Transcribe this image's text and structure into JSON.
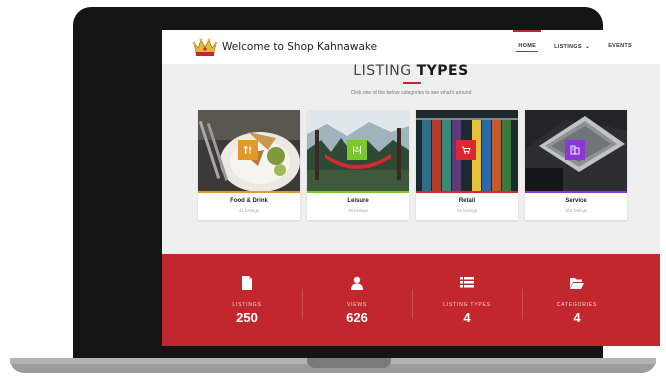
{
  "header": {
    "site_title": "Welcome to Shop Kahnawake",
    "nav": [
      {
        "label": "HOME",
        "active": true
      },
      {
        "label": "LISTINGS",
        "dropdown_icon": "chevron-down-icon"
      },
      {
        "label": "EVENTS"
      }
    ]
  },
  "section": {
    "title_light": "LISTING",
    "title_bold": "TYPES",
    "subtitle": "Click one of the below categories to see what's around"
  },
  "categories": [
    {
      "name": "Food & Drink",
      "count": "41 listings",
      "icon": "cutlery-icon",
      "color": "#e0992a"
    },
    {
      "name": "Leisure",
      "count": "26 listings",
      "icon": "hammock-icon",
      "color": "#7cc72e"
    },
    {
      "name": "Retail",
      "count": "54 listings",
      "icon": "shopping-cart-icon",
      "color": "#d9282f"
    },
    {
      "name": "Service",
      "count": "163 listings",
      "icon": "building-icon",
      "color": "#8c36d8"
    }
  ],
  "stats": [
    {
      "label": "LISTINGS",
      "value": "250",
      "icon": "file-icon"
    },
    {
      "label": "VIEWS",
      "value": "626",
      "icon": "user-icon"
    },
    {
      "label": "LISTING TYPES",
      "value": "4",
      "icon": "list-icon"
    },
    {
      "label": "CATEGORIES",
      "value": "4",
      "icon": "folder-open-icon"
    }
  ],
  "colors": {
    "accent": "#c1272d"
  }
}
